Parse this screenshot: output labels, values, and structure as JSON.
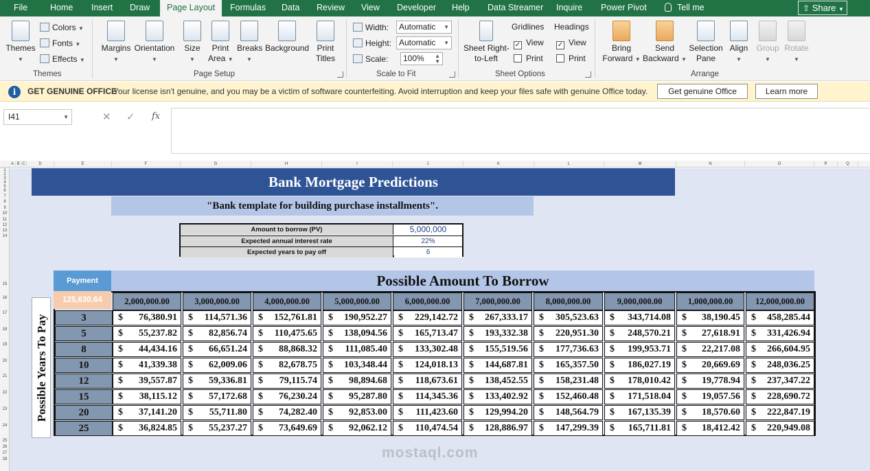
{
  "tabs": [
    "File",
    "Home",
    "Insert",
    "Draw",
    "Page Layout",
    "Formulas",
    "Data",
    "Review",
    "View",
    "Developer",
    "Help",
    "Data Streamer",
    "Inquire",
    "Power Pivot"
  ],
  "active_tab": "Page Layout",
  "tell_me": "Tell me",
  "share": "Share",
  "ribbon": {
    "themes": {
      "themes_label": "Themes",
      "colors": "Colors",
      "fonts": "Fonts",
      "effects": "Effects",
      "group": "Themes"
    },
    "page_setup": {
      "margins": "Margins",
      "orientation": "Orientation",
      "size": "Size",
      "print_area_1": "Print",
      "print_area_2": "Area",
      "breaks": "Breaks",
      "background": "Background",
      "print_titles_1": "Print",
      "print_titles_2": "Titles",
      "group": "Page Setup"
    },
    "scale": {
      "width_label": "Width:",
      "width_value": "Automatic",
      "height_label": "Height:",
      "height_value": "Automatic",
      "scale_label": "Scale:",
      "scale_value": "100%",
      "group": "Scale to Fit"
    },
    "sheet_options": {
      "rtl_1": "Sheet Right-",
      "rtl_2": "to-Left",
      "gridlines": "Gridlines",
      "headings": "Headings",
      "view": "View",
      "print": "Print",
      "group": "Sheet Options"
    },
    "arrange": {
      "bring_1": "Bring",
      "bring_2": "Forward",
      "send_1": "Send",
      "send_2": "Backward",
      "selection_1": "Selection",
      "selection_2": "Pane",
      "align": "Align",
      "group_btn": "Group",
      "rotate": "Rotate",
      "group": "Arrange"
    }
  },
  "banner": {
    "title": "GET GENUINE OFFICE",
    "message": "Your license isn't genuine, and you may be a victim of software counterfeiting. Avoid interruption and keep your files safe with genuine Office today.",
    "button_primary": "Get genuine Office",
    "button_secondary": "Learn more"
  },
  "formula_bar": {
    "name_box": "I41",
    "fx": "fx",
    "cancel": "✕",
    "enter": "✓"
  },
  "columns": [
    "A",
    "B",
    "C",
    "D",
    "E",
    "F",
    "G",
    "H",
    "I",
    "J",
    "K",
    "L",
    "M",
    "N",
    "O",
    "P",
    "Q"
  ],
  "rows": [
    "1",
    "2",
    "3",
    "4",
    "5",
    "6",
    "7",
    "8",
    "9",
    "10",
    "11",
    "12",
    "13",
    "14",
    "15",
    "16",
    "17",
    "18",
    "19",
    "20",
    "21",
    "22",
    "23",
    "24",
    "25",
    "26",
    "27",
    "28"
  ],
  "sheet": {
    "title": "Bank Mortgage Predictions",
    "subtitle": "\"Bank template for building purchase installments\".",
    "inputs": [
      {
        "label": "Amount to borrow (PV)",
        "value": "5,000,000"
      },
      {
        "label": "Expected annual interest rate",
        "value": "22%"
      },
      {
        "label": "Expected years to pay off",
        "value": "6"
      }
    ],
    "payment_label": "Payment",
    "payment_value": "125,630.64",
    "amount_header": "Possible Amount To Borrow",
    "years_label": "Possible Years To Pay",
    "currency": "$",
    "amounts": [
      "2,000,000.00",
      "3,000,000.00",
      "4,000,000.00",
      "5,000,000.00",
      "6,000,000.00",
      "7,000,000.00",
      "8,000,000.00",
      "9,000,000.00",
      "1,000,000.00",
      "12,000,000.00"
    ],
    "years": [
      "3",
      "5",
      "8",
      "10",
      "12",
      "15",
      "20",
      "25"
    ],
    "table": [
      [
        "76,380.91",
        "114,571.36",
        "152,761.81",
        "190,952.27",
        "229,142.72",
        "267,333.17",
        "305,523.63",
        "343,714.08",
        "38,190.45",
        "458,285.44"
      ],
      [
        "55,237.82",
        "82,856.74",
        "110,475.65",
        "138,094.56",
        "165,713.47",
        "193,332.38",
        "220,951.30",
        "248,570.21",
        "27,618.91",
        "331,426.94"
      ],
      [
        "44,434.16",
        "66,651.24",
        "88,868.32",
        "111,085.40",
        "133,302.48",
        "155,519.56",
        "177,736.63",
        "199,953.71",
        "22,217.08",
        "266,604.95"
      ],
      [
        "41,339.38",
        "62,009.06",
        "82,678.75",
        "103,348.44",
        "124,018.13",
        "144,687.81",
        "165,357.50",
        "186,027.19",
        "20,669.69",
        "248,036.25"
      ],
      [
        "39,557.87",
        "59,336.81",
        "79,115.74",
        "98,894.68",
        "118,673.61",
        "138,452.55",
        "158,231.48",
        "178,010.42",
        "19,778.94",
        "237,347.22"
      ],
      [
        "38,115.12",
        "57,172.68",
        "76,230.24",
        "95,287.80",
        "114,345.36",
        "133,402.92",
        "152,460.48",
        "171,518.04",
        "19,057.56",
        "228,690.72"
      ],
      [
        "37,141.20",
        "55,711.80",
        "74,282.40",
        "92,853.00",
        "111,423.60",
        "129,994.20",
        "148,564.79",
        "167,135.39",
        "18,570.60",
        "222,847.19"
      ],
      [
        "36,824.85",
        "55,237.27",
        "73,649.69",
        "92,062.12",
        "110,474.54",
        "128,886.97",
        "147,299.39",
        "165,711.81",
        "18,412.42",
        "220,949.08"
      ]
    ]
  },
  "watermark": "mostaql.com",
  "colors": {
    "excel_green": "#217346",
    "title_blue": "#2f5496",
    "light_blue": "#b4c6e7",
    "slate": "#8497b0",
    "payment_peach": "#f8cbad",
    "banner_yellow": "#fff4ce"
  }
}
